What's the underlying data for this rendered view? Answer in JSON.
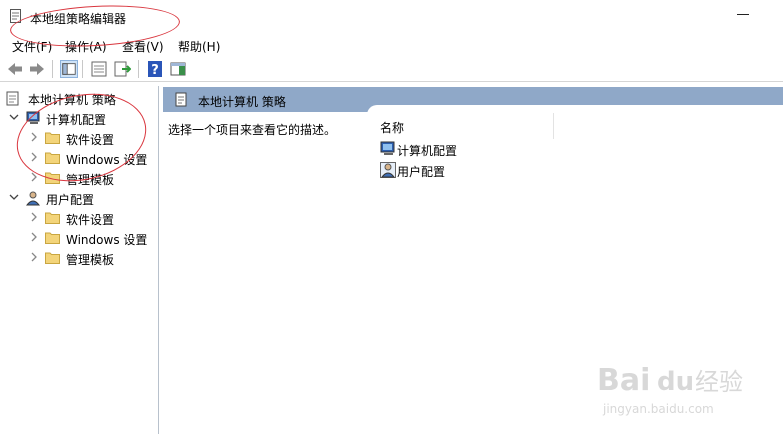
{
  "window": {
    "title": "本地组策略编辑器"
  },
  "menu": [
    {
      "label": "文件(F)"
    },
    {
      "label": "操作(A)"
    },
    {
      "label": "查看(V)"
    },
    {
      "label": "帮助(H)"
    }
  ],
  "toolbar": {
    "icons": [
      "back-icon",
      "forward-icon",
      "show-hide-tree-icon",
      "properties-icon",
      "export-list-icon",
      "help-icon",
      "show-hide-action-pane-icon"
    ]
  },
  "tree": {
    "root": "本地计算机 策略",
    "computer_config": "计算机配置",
    "computer_children": [
      "软件设置",
      "Windows 设置",
      "管理模板"
    ],
    "user_config": "用户配置",
    "user_children": [
      "软件设置",
      "Windows 设置",
      "管理模板"
    ]
  },
  "right": {
    "header": "本地计算机 策略",
    "description": "选择一个项目来查看它的描述。",
    "column_name": "名称",
    "items": [
      "计算机配置",
      "用户配置"
    ]
  },
  "watermark": {
    "brand": "Bai",
    "brand2": "du",
    "cn": "经验",
    "url": "jingyan.baidu.com"
  },
  "colors": {
    "header_bg": "#8fa8c8",
    "annotation": "#d9363e",
    "folder": "#f3d47a"
  }
}
